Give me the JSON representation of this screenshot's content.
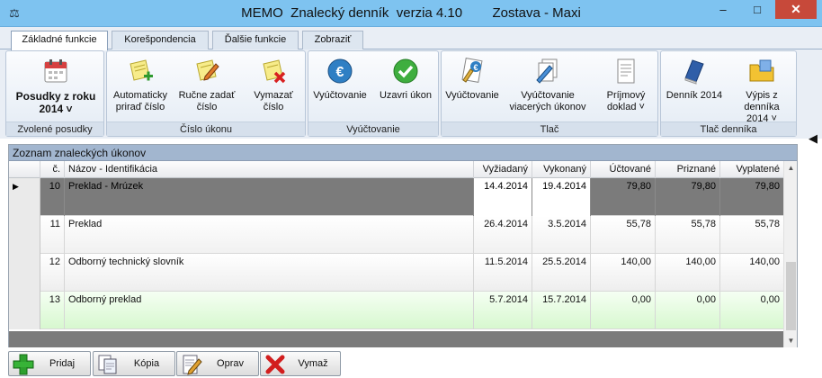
{
  "window": {
    "title": "MEMO  Znalecký denník  verzia 4.10        Zostava - Maxi",
    "minimize": "–",
    "maximize": "□",
    "close": "✕"
  },
  "ribbon": {
    "tabs": [
      "Základné funkcie",
      "Korešpondencia",
      "Ďalšie funkcie",
      "Zobraziť"
    ],
    "active_tab": "Základné funkcie",
    "groups": {
      "zvolene": {
        "label": "Zvolené posudky",
        "button": "Posudky z roku\n2014 ˅",
        "icon": "calendar-icon"
      },
      "cislo": {
        "label": "Číslo úkonu",
        "buttons": [
          {
            "label": "Automaticky\npriraď číslo",
            "icon": "note-add-icon"
          },
          {
            "label": "Ručne zadať\nčíslo",
            "icon": "note-edit-icon"
          },
          {
            "label": "Vymazať\nčíslo",
            "icon": "note-delete-icon"
          }
        ]
      },
      "vyuctovanie": {
        "label": "Vyúčtovanie",
        "buttons": [
          {
            "label": "Vyúčtovanie",
            "icon": "euro-coin-icon"
          },
          {
            "label": "Uzavri úkon",
            "icon": "check-circle-icon"
          }
        ]
      },
      "tlac": {
        "label": "Tlač",
        "buttons": [
          {
            "label": "Vyúčtovanie",
            "icon": "document-euro-icon"
          },
          {
            "label": "Vyúčtovanie\nviacerých úkonov",
            "icon": "documents-stack-icon"
          },
          {
            "label": "Príjmový\ndoklad ˅",
            "icon": "receipt-icon"
          }
        ]
      },
      "tlac_dennika": {
        "label": "Tlač denníka",
        "buttons": [
          {
            "label": "Denník 2014",
            "icon": "book-icon"
          },
          {
            "label": "Výpis z denníka\n2014 ˅",
            "icon": "folder-icon"
          }
        ]
      }
    }
  },
  "grid": {
    "caption": "Zoznam znaleckých úkonov",
    "columns": [
      "č.",
      "Názov - Identifikácia",
      "Vyžiadaný",
      "Vykonaný",
      "Účtované",
      "Priznané",
      "Vyplatené"
    ],
    "rows": [
      {
        "c": "10",
        "nazov": "Preklad - Mrúzek",
        "vyziadany": "14.4.2014",
        "vykonany": "19.4.2014",
        "uctovane": "79,80",
        "priznane": "79,80",
        "vyplatene": "79,80",
        "selected": true
      },
      {
        "c": "11",
        "nazov": "Preklad",
        "vyziadany": "26.4.2014",
        "vykonany": "3.5.2014",
        "uctovane": "55,78",
        "priznane": "55,78",
        "vyplatene": "55,78"
      },
      {
        "c": "12",
        "nazov": "Odborný technický slovník",
        "vyziadany": "11.5.2014",
        "vykonany": "25.5.2014",
        "uctovane": "140,00",
        "priznane": "140,00",
        "vyplatene": "140,00"
      },
      {
        "c": "13",
        "nazov": "Odborný preklad",
        "vyziadany": "5.7.2014",
        "vykonany": "15.7.2014",
        "uctovane": "0,00",
        "priznane": "0,00",
        "vyplatene": "0,00"
      }
    ]
  },
  "bottom": {
    "pridaj": "Pridaj",
    "kopia": "Kópia",
    "oprav": "Oprav",
    "vymaz": "Vymaž"
  },
  "colors": {
    "titlebar": "#7ec3f0",
    "selected_row": "#7b7b7b",
    "green_row": "#d7f8cf",
    "caption": "#a2b6cf"
  }
}
